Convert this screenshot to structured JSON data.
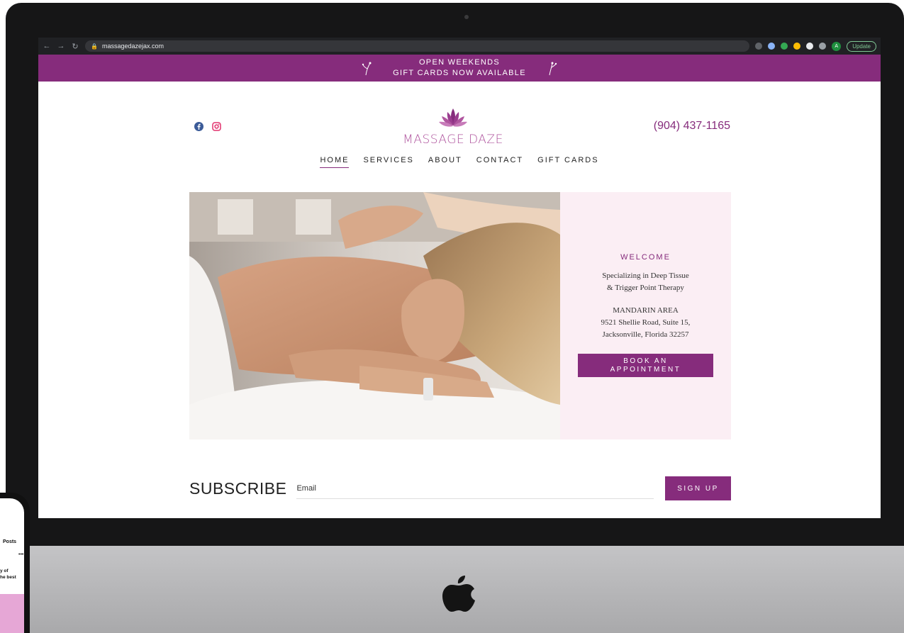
{
  "browser": {
    "url": "massagedazejax.com",
    "update_label": "Update",
    "avatar_initial": "A"
  },
  "announcement": {
    "line1": "OPEN WEEKENDS",
    "line2": "GIFT CARDS NOW AVAILABLE"
  },
  "header": {
    "brand": "MASSAGE DAZE",
    "phone": "(904) 437-1165"
  },
  "nav": {
    "items": [
      {
        "label": "HOME"
      },
      {
        "label": "SERVICES"
      },
      {
        "label": "ABOUT"
      },
      {
        "label": "CONTACT"
      },
      {
        "label": "GIFT CARDS"
      }
    ]
  },
  "welcome": {
    "title": "WELCOME",
    "specialty_line1": "Specializing in Deep Tissue",
    "specialty_line2": "& Trigger Point Therapy",
    "area": "MANDARIN AREA",
    "address_line1": "9521 Shellie Road, Suite 15,",
    "address_line2": "Jacksonville, Florida 32257",
    "book_line1": "BOOK AN",
    "book_line2": "APPOINTMENT"
  },
  "subscribe": {
    "title": "SUBSCRIBE",
    "email_placeholder": "Email",
    "signup_label": "SIGN UP"
  },
  "phone_mock": {
    "posts": "Posts",
    "dots": "•••",
    "caption_line1": "y of",
    "caption_line2": "he best"
  },
  "colors": {
    "brand_purple": "#862c7c",
    "logo_pink": "#b0569f",
    "panel_pink": "#fbeef4"
  }
}
